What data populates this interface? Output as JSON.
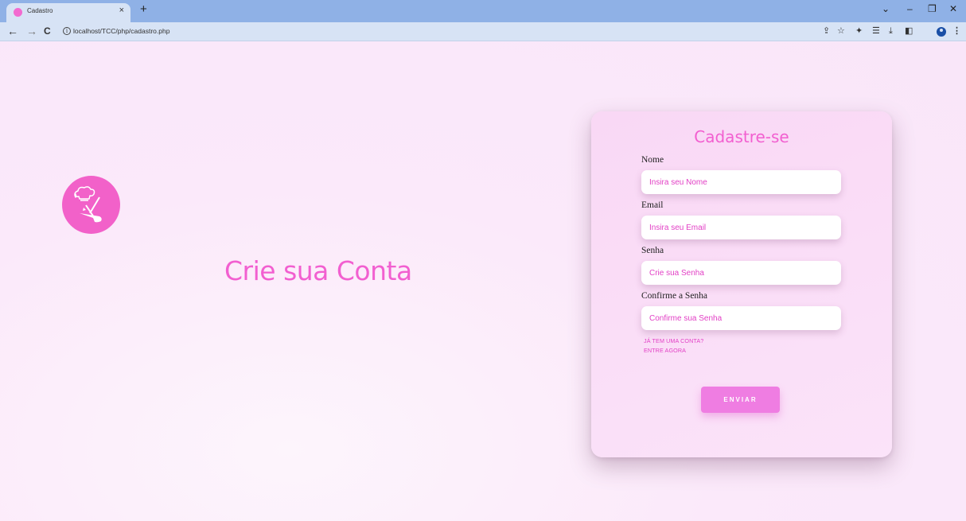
{
  "browser": {
    "tab_title": "Cadastro",
    "tab_close": "×",
    "new_tab": "+",
    "url": "localhost/TCC/php/cadastro.php",
    "window_controls": {
      "dropdown": "⌄",
      "minimize": "–",
      "restore": "❐",
      "close": "✕"
    },
    "nav": {
      "back": "←",
      "forward": "→",
      "reload": "C",
      "info": "i"
    },
    "toolbar_icons": {
      "share": "⇪",
      "bookmark": "☆",
      "extensions": "✦",
      "reading_list": "☰",
      "download": "⤓",
      "side_panel": "◧",
      "menu": "⋮"
    }
  },
  "hero": {
    "headline": "Crie sua Conta",
    "logo_icon": "chef-hat-utensils-icon"
  },
  "form": {
    "title": "Cadastre-se",
    "fields": [
      {
        "label": "Nome",
        "placeholder": "Insira seu Nome"
      },
      {
        "label": "Email",
        "placeholder": "Insira seu Email"
      },
      {
        "label": "Senha",
        "placeholder": "Crie sua Senha"
      },
      {
        "label": "Confirme a Senha",
        "placeholder": "Confirme sua Senha"
      }
    ],
    "login_prompt": "JÁ TEM UMA CONTA?",
    "login_link": "ENTRE AGORA",
    "submit_label": "ENVIAR"
  },
  "colors": {
    "accent": "#f25fd0",
    "button": "#ef7de2",
    "background": "#fbe9fa",
    "tab_bar": "#8fb1e6"
  }
}
